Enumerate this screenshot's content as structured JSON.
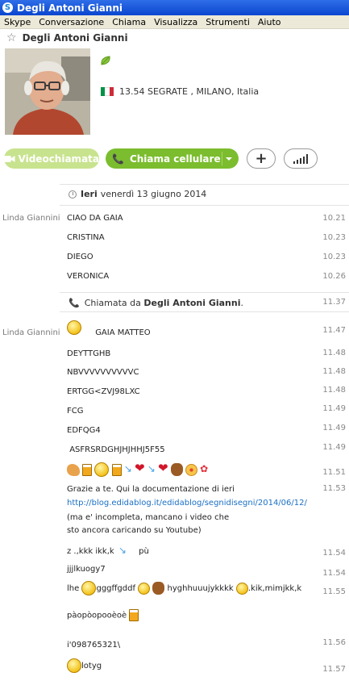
{
  "window": {
    "title": "Degli Antoni Gianni"
  },
  "menu": [
    "Skype",
    "Conversazione",
    "Chiama",
    "Visualizza",
    "Strumenti",
    "Aiuto"
  ],
  "contact": {
    "name": "Degli Antoni Gianni",
    "location": "13.54 SEGRATE , MILANO, Italia",
    "status_icon": "leaf-icon",
    "flag_colors": [
      "#009246",
      "#ffffff",
      "#ce2b37"
    ]
  },
  "actions": {
    "video": "Videochiamata",
    "call": "Chiama cellulare"
  },
  "colors": {
    "accent_green": "#7bbd2e",
    "link": "#1a6fc4"
  },
  "conversation": {
    "date_label": "Ieri",
    "date_text": "venerdì 13 giugno 2014",
    "call_prefix": "Chiamata da",
    "call_name": "Degli Antoni Gianni",
    "call_suffix": ".",
    "call_time": "11.37"
  },
  "messages": [
    {
      "sender": "Linda Giannini",
      "text": "CIAO   DA   GAIA",
      "time": "10.21"
    },
    {
      "text": "CRISTINA",
      "time": "10.23"
    },
    {
      "text": "DIEGO",
      "time": "10.23"
    },
    {
      "text": "VERONICA",
      "time": "10.26"
    },
    {
      "sender": "Linda Giannini",
      "text": "GAIA         MATTEO",
      "time": "11.47"
    },
    {
      "text": "DEYTTGHB",
      "time": "11.48"
    },
    {
      "text": "NBVVVVVVVVVVC",
      "time": "11.48"
    },
    {
      "text": "ERTGG<ZVJ98LXC",
      "time": "11.48"
    },
    {
      "text": "FCG",
      "time": "11.49"
    },
    {
      "text": "EDFQG4",
      "time": "11.49"
    },
    {
      "text": "ASFRSRDGHJHJHHJ5F55",
      "time": "11.49"
    },
    {
      "text": "",
      "time": "11.51"
    },
    {
      "text": "Grazie a te. Qui la documentazione di ieri",
      "link": "http://blog.edidablog.it/edidablog/segnidisegni/2014/06/12/",
      "line3": "(ma e' incompleta, mancano i video che",
      "line4": "sto ancora caricando su Youtube)",
      "time": "11.53"
    },
    {
      "text": "z .,kkk ikk,k",
      "text2": "pù",
      "time": "11.54"
    },
    {
      "text": "jjjlkuogy7",
      "time": "11.54"
    },
    {
      "text": "lhe",
      "text2": "gggffgddf",
      "text3": "hyghhuuujykkkk",
      "text4": ".kik,mimjkk,k",
      "time": "11.55"
    },
    {
      "text": "pàopòopooèoè",
      "time": ""
    },
    {
      "text": "i'098765321\\",
      "time": "11.56"
    },
    {
      "text": "lotyg",
      "time": "11.57"
    }
  ]
}
